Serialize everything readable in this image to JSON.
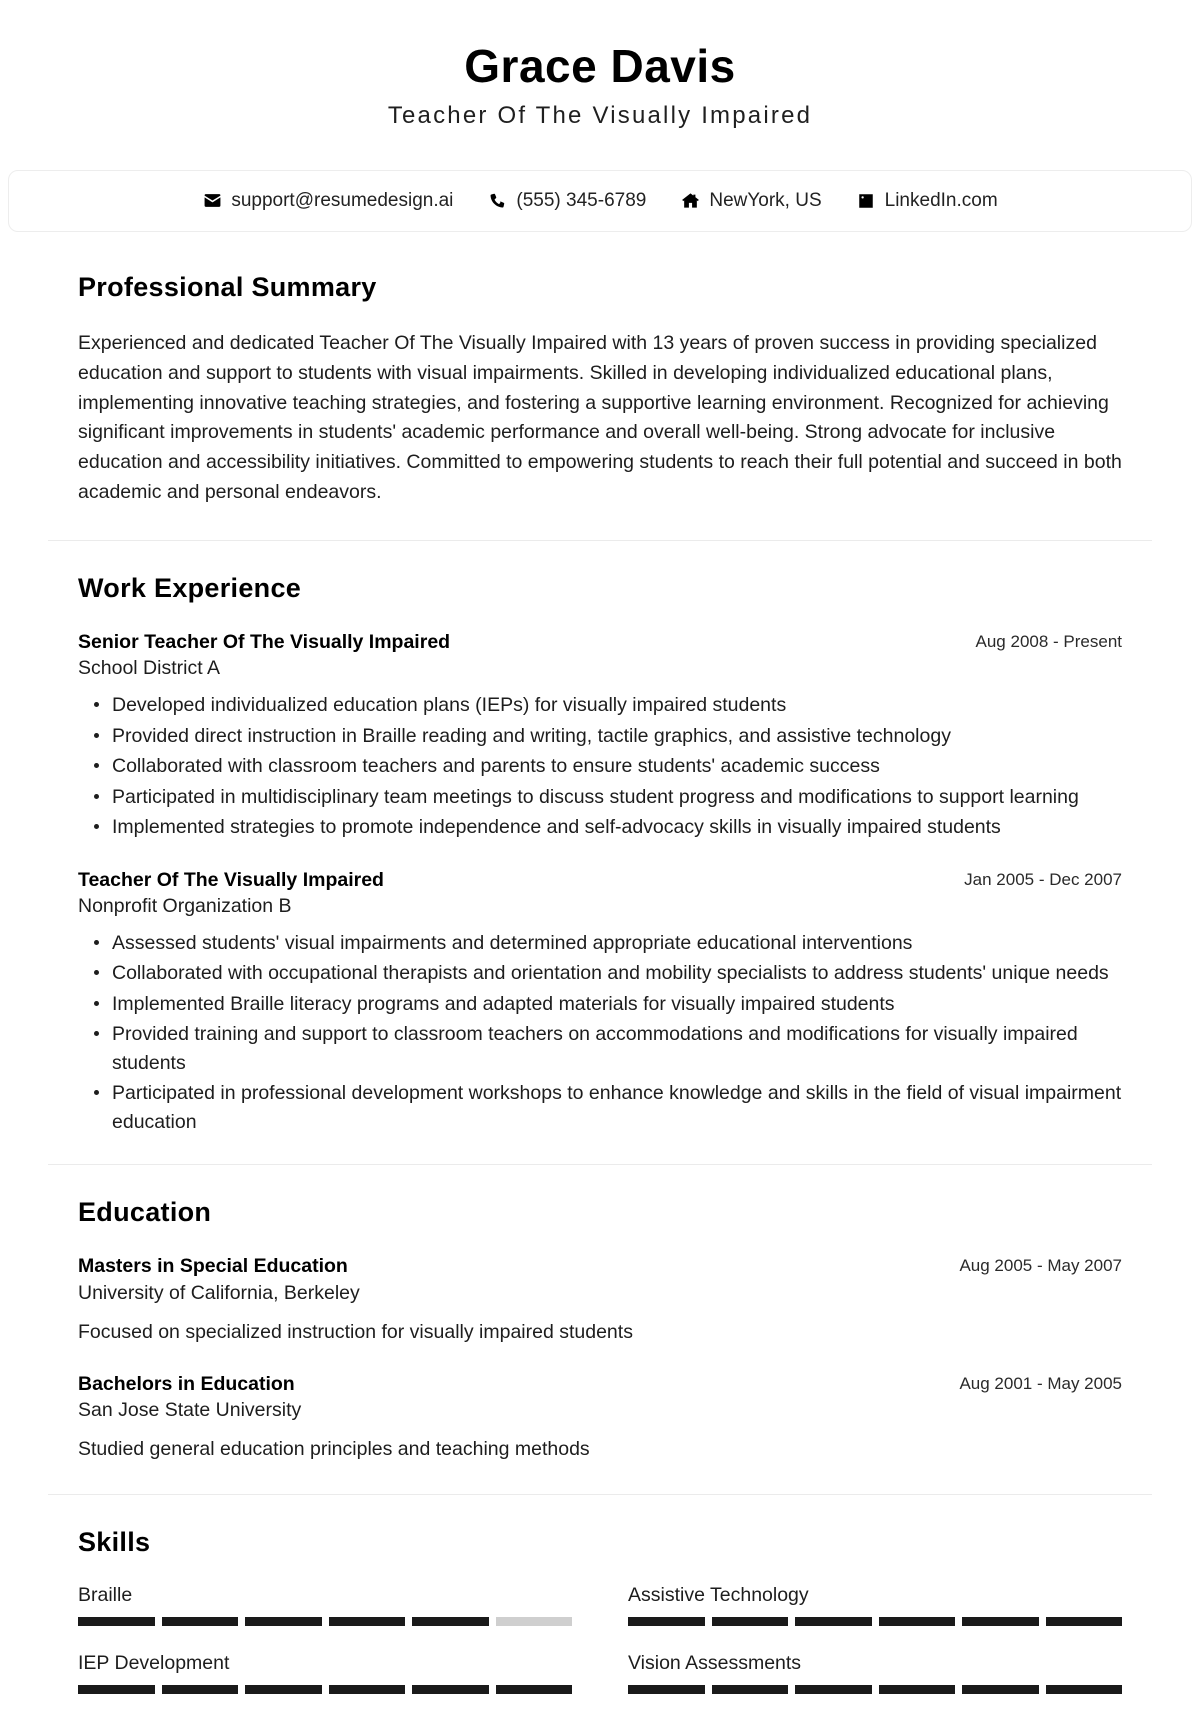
{
  "header": {
    "name": "Grace Davis",
    "job_title": "Teacher Of The Visually Impaired"
  },
  "contact": {
    "email": "support@resumedesign.ai",
    "phone": "(555) 345-6789",
    "location": "NewYork, US",
    "linkedin": "LinkedIn.com",
    "icons": {
      "email": "envelope-icon",
      "phone": "phone-icon",
      "location": "home-icon",
      "linkedin": "linkedin-icon"
    }
  },
  "summary": {
    "title": "Professional Summary",
    "text": "Experienced and dedicated Teacher Of The Visually Impaired with 13 years of proven success in providing specialized education and support to students with visual impairments. Skilled in developing individualized educational plans, implementing innovative teaching strategies, and fostering a supportive learning environment. Recognized for achieving significant improvements in students' academic performance and overall well-being. Strong advocate for inclusive education and accessibility initiatives. Committed to empowering students to reach their full potential and succeed in both academic and personal endeavors."
  },
  "work": {
    "title": "Work Experience",
    "entries": [
      {
        "role": "Senior Teacher Of The Visually Impaired",
        "org": "School District A",
        "date": "Aug 2008 - Present",
        "bullets": [
          "Developed individualized education plans (IEPs) for visually impaired students",
          "Provided direct instruction in Braille reading and writing, tactile graphics, and assistive technology",
          "Collaborated with classroom teachers and parents to ensure students' academic success",
          "Participated in multidisciplinary team meetings to discuss student progress and modifications to support learning",
          "Implemented strategies to promote independence and self-advocacy skills in visually impaired students"
        ]
      },
      {
        "role": "Teacher Of The Visually Impaired",
        "org": "Nonprofit Organization B",
        "date": "Jan 2005 - Dec 2007",
        "bullets": [
          "Assessed students' visual impairments and determined appropriate educational interventions",
          "Collaborated with occupational therapists and orientation and mobility specialists to address students' unique needs",
          "Implemented Braille literacy programs and adapted materials for visually impaired students",
          "Provided training and support to classroom teachers on accommodations and modifications for visually impaired students",
          "Participated in professional development workshops to enhance knowledge and skills in the field of visual impairment education"
        ]
      }
    ]
  },
  "education": {
    "title": "Education",
    "entries": [
      {
        "degree": "Masters in Special Education",
        "school": "University of California, Berkeley",
        "date": "Aug 2005 - May 2007",
        "description": "Focused on specialized instruction for visually impaired students"
      },
      {
        "degree": "Bachelors in Education",
        "school": "San Jose State University",
        "date": "Aug 2001 - May 2005",
        "description": "Studied general education principles and teaching methods"
      }
    ]
  },
  "skills": {
    "title": "Skills",
    "total_segments": 6,
    "items": [
      {
        "name": "Braille",
        "filled": 5
      },
      {
        "name": "Assistive Technology",
        "filled": 6
      },
      {
        "name": "IEP Development",
        "filled": 6
      },
      {
        "name": "Vision Assessments",
        "filled": 6
      }
    ]
  }
}
